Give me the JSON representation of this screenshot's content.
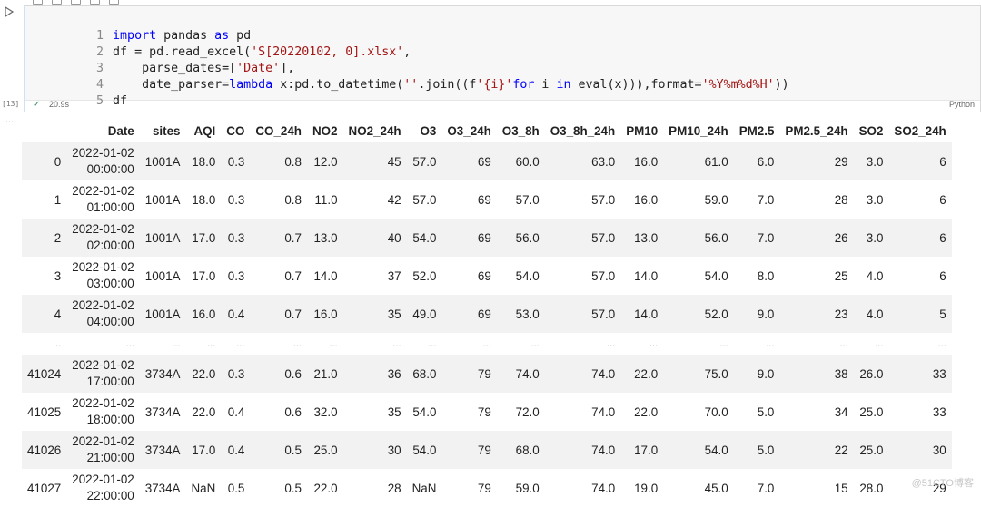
{
  "code": {
    "language": "Python",
    "elapsed": "20.9s",
    "exec_count": "[13]",
    "lines": [
      {
        "n": "1"
      },
      {
        "n": "2"
      },
      {
        "n": "3"
      },
      {
        "n": "4"
      },
      {
        "n": "5"
      }
    ],
    "tokens": {
      "l1_kw1": "import",
      "l1_t1": " pandas ",
      "l1_kw2": "as",
      "l1_t2": " pd",
      "l2_t1": "df = pd.read_excel(",
      "l2_s1": "'S[20220102, 0].xlsx'",
      "l2_t2": ",",
      "l3_t1": "    parse_dates=[",
      "l3_s1": "'Date'",
      "l3_t2": "],",
      "l4_t1": "    date_parser=",
      "l4_kw1": "lambda",
      "l4_t2": " x:pd.to_datetime(",
      "l4_s1": "''",
      "l4_t3": ".join((f",
      "l4_s2": "'{i}'",
      "l4_kw2": "for",
      "l4_t4": " i ",
      "l4_kw3": "in",
      "l4_t5": " eval(x))),format=",
      "l4_s3": "'%Y%m%d%H'",
      "l4_t6": "))",
      "l5_t1": "df"
    }
  },
  "output": {
    "dots": "...",
    "columns": [
      "Date",
      "sites",
      "AQI",
      "CO",
      "CO_24h",
      "NO2",
      "NO2_24h",
      "O3",
      "O3_24h",
      "O3_8h",
      "O3_8h_24h",
      "PM10",
      "PM10_24h",
      "PM2.5",
      "PM2.5_24h",
      "SO2",
      "SO2_24h"
    ],
    "rows": [
      {
        "idx": "0",
        "date1": "2022-01-02",
        "date2": "00:00:00",
        "cells": [
          "1001A",
          "18.0",
          "0.3",
          "0.8",
          "12.0",
          "45",
          "57.0",
          "69",
          "60.0",
          "63.0",
          "16.0",
          "61.0",
          "6.0",
          "29",
          "3.0",
          "6"
        ]
      },
      {
        "idx": "1",
        "date1": "2022-01-02",
        "date2": "01:00:00",
        "cells": [
          "1001A",
          "18.0",
          "0.3",
          "0.8",
          "11.0",
          "42",
          "57.0",
          "69",
          "57.0",
          "57.0",
          "16.0",
          "59.0",
          "7.0",
          "28",
          "3.0",
          "6"
        ]
      },
      {
        "idx": "2",
        "date1": "2022-01-02",
        "date2": "02:00:00",
        "cells": [
          "1001A",
          "17.0",
          "0.3",
          "0.7",
          "13.0",
          "40",
          "54.0",
          "69",
          "56.0",
          "57.0",
          "13.0",
          "56.0",
          "7.0",
          "26",
          "3.0",
          "6"
        ]
      },
      {
        "idx": "3",
        "date1": "2022-01-02",
        "date2": "03:00:00",
        "cells": [
          "1001A",
          "17.0",
          "0.3",
          "0.7",
          "14.0",
          "37",
          "52.0",
          "69",
          "54.0",
          "57.0",
          "14.0",
          "54.0",
          "8.0",
          "25",
          "4.0",
          "6"
        ]
      },
      {
        "idx": "4",
        "date1": "2022-01-02",
        "date2": "04:00:00",
        "cells": [
          "1001A",
          "16.0",
          "0.4",
          "0.7",
          "16.0",
          "35",
          "49.0",
          "69",
          "53.0",
          "57.0",
          "14.0",
          "52.0",
          "9.0",
          "23",
          "4.0",
          "5"
        ]
      },
      {
        "ellipsis": "..."
      },
      {
        "idx": "41024",
        "date1": "2022-01-02",
        "date2": "17:00:00",
        "cells": [
          "3734A",
          "22.0",
          "0.3",
          "0.6",
          "21.0",
          "36",
          "68.0",
          "79",
          "74.0",
          "74.0",
          "22.0",
          "75.0",
          "9.0",
          "38",
          "26.0",
          "33"
        ]
      },
      {
        "idx": "41025",
        "date1": "2022-01-02",
        "date2": "18:00:00",
        "cells": [
          "3734A",
          "22.0",
          "0.4",
          "0.6",
          "32.0",
          "35",
          "54.0",
          "79",
          "72.0",
          "74.0",
          "22.0",
          "70.0",
          "5.0",
          "34",
          "25.0",
          "33"
        ]
      },
      {
        "idx": "41026",
        "date1": "2022-01-02",
        "date2": "21:00:00",
        "cells": [
          "3734A",
          "17.0",
          "0.4",
          "0.5",
          "25.0",
          "30",
          "54.0",
          "79",
          "68.0",
          "74.0",
          "17.0",
          "54.0",
          "5.0",
          "22",
          "25.0",
          "30"
        ]
      },
      {
        "idx": "41027",
        "date1": "2022-01-02",
        "date2": "22:00:00",
        "cells": [
          "3734A",
          "NaN",
          "0.5",
          "0.5",
          "22.0",
          "28",
          "NaN",
          "79",
          "59.0",
          "74.0",
          "19.0",
          "45.0",
          "7.0",
          "15",
          "28.0",
          "29"
        ]
      }
    ]
  },
  "watermark": "@51CTO博客",
  "colors": {
    "keyword": "#0000ff",
    "string": "#a31515",
    "cell_border": "#cfe2f3"
  }
}
